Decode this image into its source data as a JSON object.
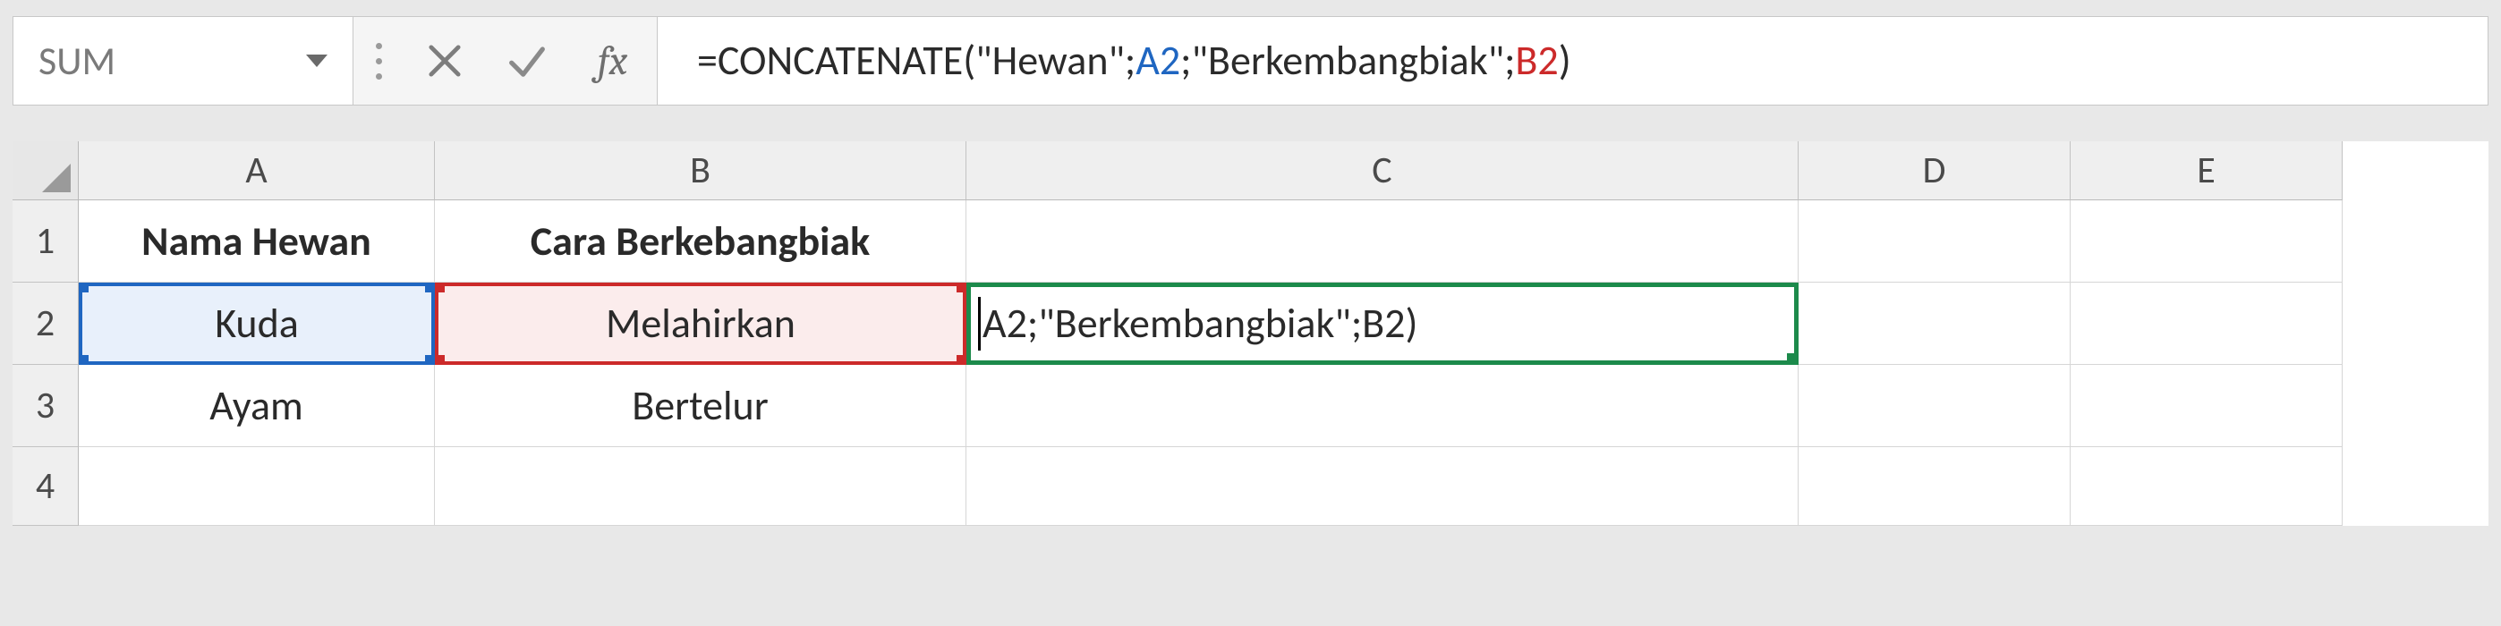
{
  "formula_bar": {
    "name_box": "SUM",
    "fx_label": "fx",
    "formula_tokens": [
      {
        "cls": "t-black",
        "text": "=CONCATENATE(\"Hewan\";"
      },
      {
        "cls": "t-blue",
        "text": "A2"
      },
      {
        "cls": "t-black",
        "text": ";\"Berkembangbiak\";"
      },
      {
        "cls": "t-red",
        "text": "B2"
      },
      {
        "cls": "t-black",
        "text": ")"
      }
    ]
  },
  "columns": {
    "A": "A",
    "B": "B",
    "C": "C",
    "D": "D",
    "E": "E"
  },
  "rows": {
    "1": "1",
    "2": "2",
    "3": "3",
    "4": "4"
  },
  "cells": {
    "A1": "Nama Hewan",
    "B1": "Cara Berkebangbiak",
    "A2": "Kuda",
    "B2": "Melahirkan",
    "C2_visible": "A2;\"Berkembangbiak\";B2)",
    "A3": "Ayam",
    "B3": "Bertelur"
  },
  "colors": {
    "ref_blue": "#1f66c1",
    "ref_red": "#cc2a2a",
    "active_green": "#1c8a4b"
  }
}
